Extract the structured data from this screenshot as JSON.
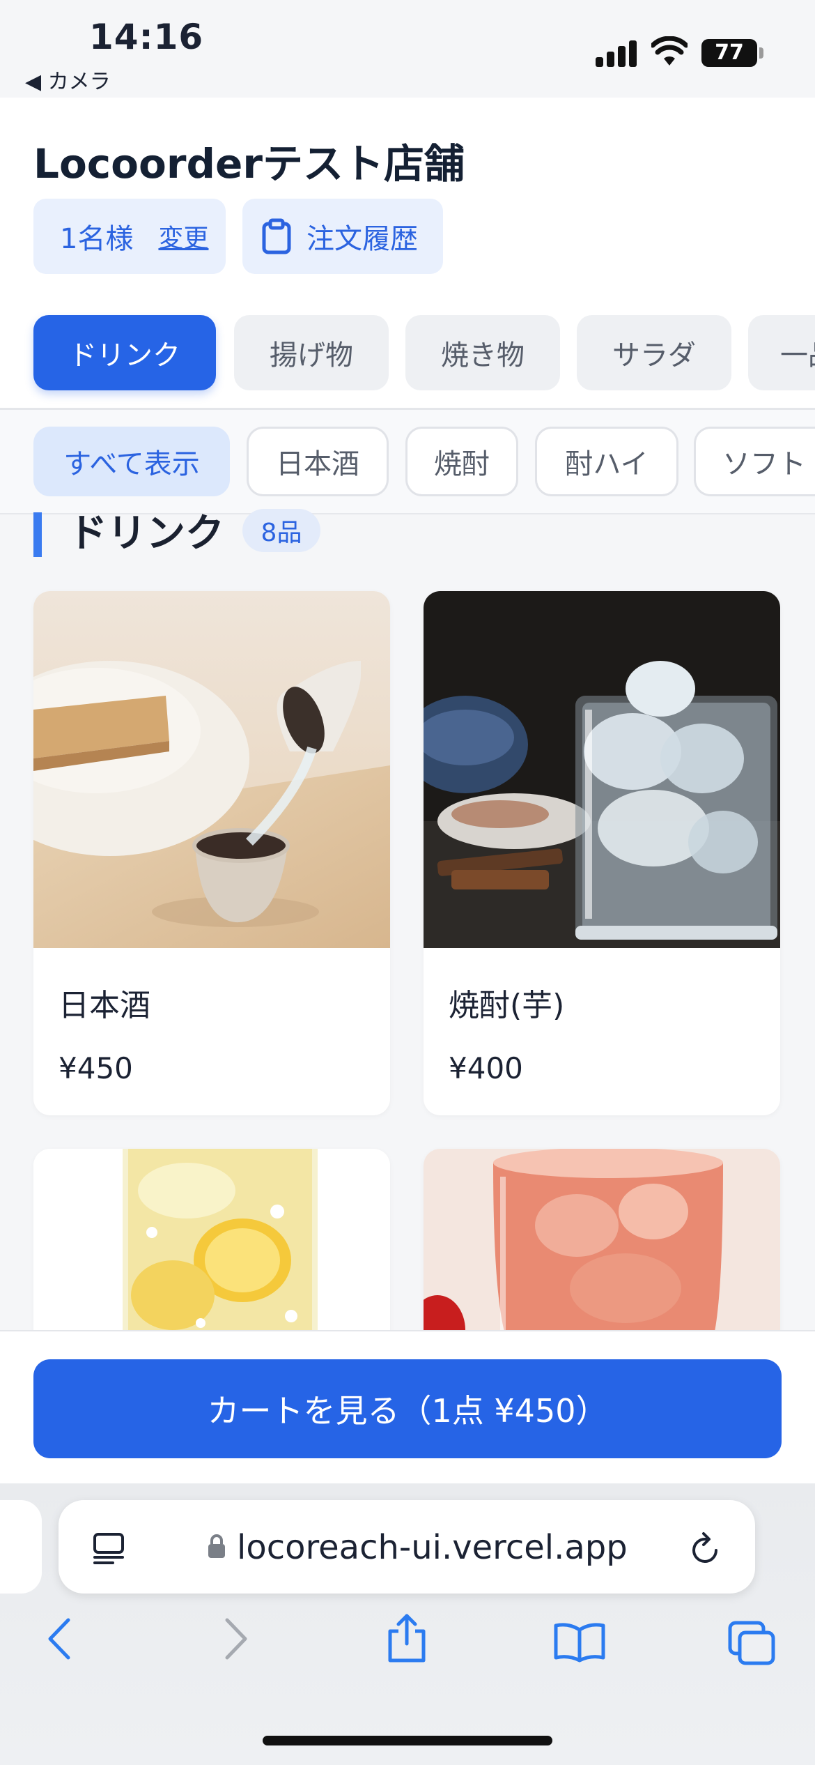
{
  "status_bar": {
    "time": "14:16",
    "back_app": "◀ カメラ",
    "battery": "77"
  },
  "header": {
    "shop_name": "Locoorderテスト店舗",
    "guest_count": "1名様",
    "change_label": "変更",
    "history_label": "注文履歴"
  },
  "categories": [
    {
      "label": "ドリンク",
      "active": true
    },
    {
      "label": "揚げ物"
    },
    {
      "label": "焼き物"
    },
    {
      "label": "サラダ"
    },
    {
      "label": "一品"
    }
  ],
  "subcategories": [
    {
      "label": "すべて表示",
      "active": true
    },
    {
      "label": "日本酒"
    },
    {
      "label": "焼酎"
    },
    {
      "label": "酎ハイ"
    },
    {
      "label": "ソフト"
    }
  ],
  "section": {
    "title": "ドリンク",
    "count": "8品"
  },
  "items": [
    {
      "name": "日本酒",
      "price": "¥450"
    },
    {
      "name": "焼酎(芋)",
      "price": "¥400"
    },
    {
      "name": "",
      "price": ""
    },
    {
      "name": "",
      "price": ""
    }
  ],
  "cart": {
    "label": "カートを見る（1点 ¥450）"
  },
  "browser": {
    "url": "locoreach-ui.vercel.app"
  },
  "colors": {
    "accent": "#2664e6",
    "accent_light": "#e9f0fd",
    "background": "#f5f6f8"
  }
}
